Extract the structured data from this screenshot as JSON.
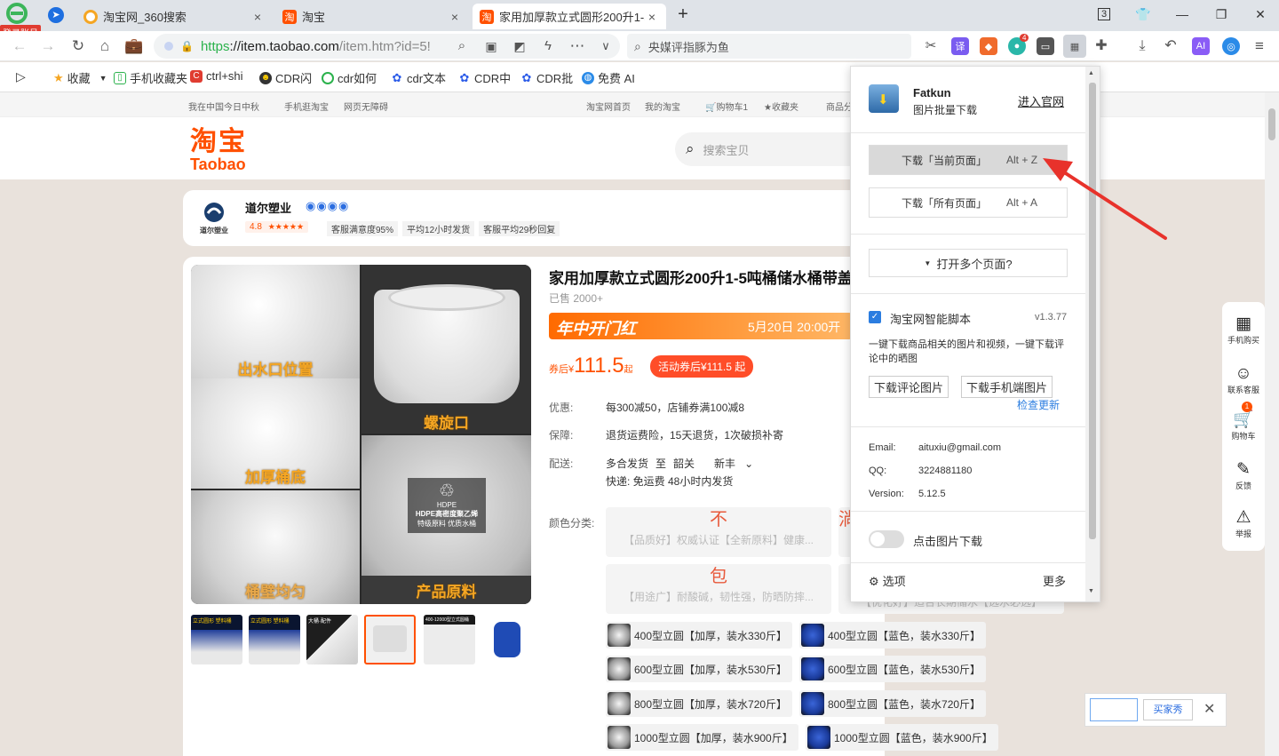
{
  "browser": {
    "login_badge": "登录账号",
    "tabs": [
      {
        "title": "淘宝网_360搜索",
        "close": "×"
      },
      {
        "title": "淘宝",
        "close": "×"
      },
      {
        "title": "家用加厚款立式圆形200升1-5",
        "close": "×"
      }
    ],
    "new_tab": "+",
    "tab_count": "3",
    "url_scheme": "https",
    "url_host": "://item.taobao.com",
    "url_path": "/item.htm?id=5!",
    "search_placeholder": "央媒评指豚为鱼",
    "ext_badge": "4"
  },
  "bookmarks": [
    {
      "label": "收藏"
    },
    {
      "label": "手机收藏夹"
    },
    {
      "label": "ctrl+shi"
    },
    {
      "label": "CDR闪"
    },
    {
      "label": "cdr如何"
    },
    {
      "label": "cdr文本"
    },
    {
      "label": "CDR中"
    },
    {
      "label": "CDR批"
    },
    {
      "label": "免费 AI"
    }
  ],
  "topnav": {
    "left": [
      "我在中国今日中秋",
      "手机逛淘宝",
      "网页无障碍"
    ],
    "right": [
      "淘宝网首页",
      "我的淘宝",
      "购物车1",
      "收藏夹",
      "商品分"
    ]
  },
  "header": {
    "logo_cn": "淘宝",
    "logo_en": "Taobao",
    "search_placeholder": "搜索宝贝"
  },
  "shop": {
    "logo_text": "道尔塑业",
    "name": "道尔塑业",
    "rating": "4.8",
    "stars": "★★★★★",
    "tags": [
      "客服满意度95%",
      "平均12小时发货",
      "客服平均29秒回复"
    ]
  },
  "gallery": {
    "captions": [
      "出水口位置",
      "螺旋口",
      "加厚桶底",
      "HDPE高密度聚乙烯",
      "桶壁均匀",
      "产品原料"
    ],
    "recycle_sub": "HDPE",
    "recycle_text": "特级原料 优质水桶"
  },
  "thumbs": [
    {
      "label": "立式圆形 塑料桶"
    },
    {
      "label": "立式圆形 塑料桶"
    },
    {
      "label": "大桶·配件"
    },
    {
      "label": ""
    },
    {
      "label": "400-12000型立式圆桶"
    },
    {
      "label": ""
    }
  ],
  "product": {
    "title": "家用加厚款立式圆形200升1-5吨桶储水桶带盖",
    "sold": "已售 2000+",
    "promo_title": "年中开门红",
    "promo_time": "5月20日 20:00开",
    "price_prefix": "券后¥",
    "price": "111.5",
    "price_suffix": "起",
    "coupon": "活动券后¥111.5 起",
    "discount_label": "优惠:",
    "discount": "每300减50，店铺券满100减8",
    "guarantee_label": "保障:",
    "guarantee": "退货运费险，15天退货，1次破损补寄",
    "delivery_label": "配送:",
    "delivery_from": "多合发货",
    "delivery_to_word": "至",
    "delivery_to": "韶关",
    "delivery_area": "新丰",
    "delivery_note": "快递: 免运费  48小时内发货",
    "color_label": "颜色分类:",
    "big_options": [
      {
        "char": "不",
        "text": "【品质好】权威认证【全新原料】健康..."
      },
      {
        "char": "淌",
        "text": ""
      },
      {
        "char": "包",
        "text": "【用途广】耐酸碱，韧性强，防晒防摔..."
      },
      {
        "char": "",
        "text": "【优化好】适合长期储水【选水必选】"
      }
    ],
    "options": [
      "400型立圆【加厚，装水330斤】",
      "400型立圆【蓝色，装水330斤】",
      "600型立圆【加厚，装水530斤】",
      "600型立圆【蓝色，装水530斤】",
      "800型立圆【加厚，装水720斤】",
      "800型立圆【蓝色，装水720斤】",
      "1000型立圆【加厚，装水900斤】",
      "1000型立圆【蓝色，装水900斤】"
    ]
  },
  "fatkun": {
    "name": "Fatkun",
    "subtitle": "图片批量下载",
    "website": "进入官网",
    "btn_current": "下载「当前页面」",
    "btn_current_key": "Alt + Z",
    "btn_all": "下载「所有页面」",
    "btn_all_key": "Alt + A",
    "open_multi": "打开多个页面?",
    "script_name": "淘宝网智能脚本",
    "script_version": "v1.3.77",
    "script_desc": "一键下载商品相关的图片和视频，一键下载评论中的晒图",
    "btn_review": "下载评论图片",
    "btn_mobile": "下载手机端图片",
    "check_update": "检查更新",
    "email_label": "Email:",
    "email": "aituxiu@gmail.com",
    "qq_label": "QQ:",
    "qq": "3224881180",
    "version_label": "Version:",
    "version": "5.12.5",
    "click_download": "点击图片下载",
    "options": "选项",
    "more": "更多"
  },
  "right_float": [
    {
      "label": "手机购买"
    },
    {
      "label": "联系客服"
    },
    {
      "label": "购物车",
      "badge": "1"
    },
    {
      "label": "反馈"
    },
    {
      "label": "举报"
    }
  ],
  "bottom_widget": {
    "button": "买家秀",
    "close": "✕"
  }
}
